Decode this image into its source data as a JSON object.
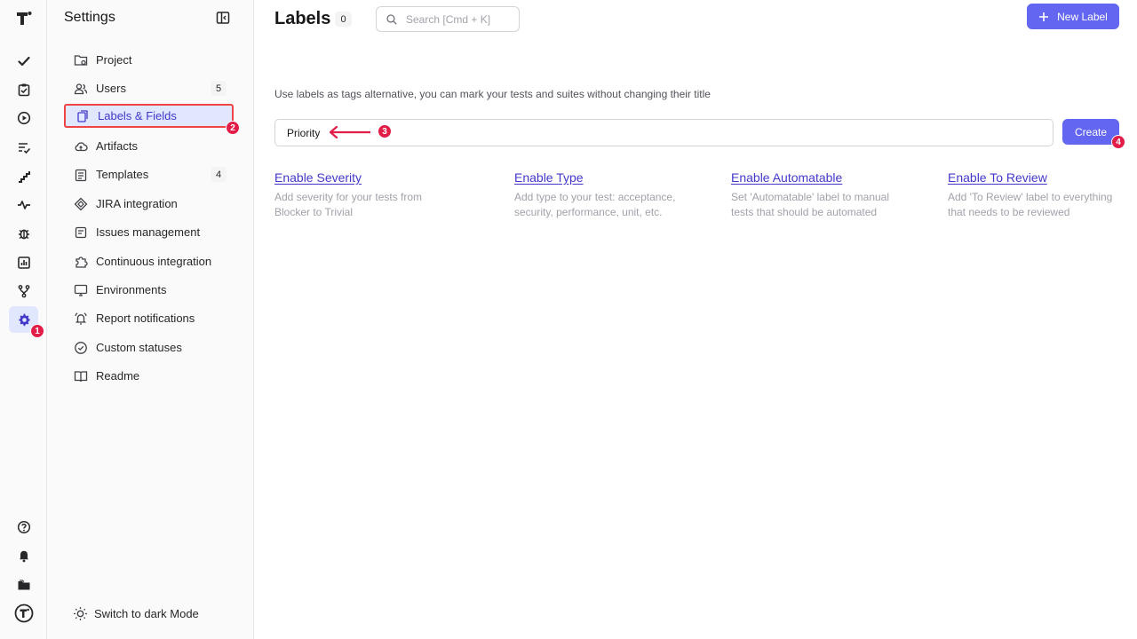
{
  "rail": {
    "items": [
      {
        "name": "checkmark-icon"
      },
      {
        "name": "clipboard-check-icon"
      },
      {
        "name": "play-circle-icon"
      },
      {
        "name": "list-check-icon"
      },
      {
        "name": "steps-icon"
      },
      {
        "name": "pulse-icon"
      },
      {
        "name": "bug-icon"
      },
      {
        "name": "bar-chart-icon"
      },
      {
        "name": "git-branch-icon"
      },
      {
        "name": "gear-icon",
        "active": true
      }
    ],
    "bottom": [
      {
        "name": "help-circle-icon"
      },
      {
        "name": "bell-icon"
      },
      {
        "name": "folder-icon"
      },
      {
        "name": "account-logo-icon"
      }
    ]
  },
  "settings": {
    "title": "Settings",
    "items": [
      {
        "label": "Project",
        "icon": "folder-gear-icon"
      },
      {
        "label": "Users",
        "icon": "users-icon",
        "badge": "5"
      },
      {
        "label": "Labels & Fields",
        "icon": "labels-icon",
        "active": true
      },
      {
        "label": "Artifacts",
        "icon": "cloud-icon"
      },
      {
        "label": "Templates",
        "icon": "clipboard-list-icon",
        "badge": "4"
      },
      {
        "label": "JIRA integration",
        "icon": "jira-icon"
      },
      {
        "label": "Issues management",
        "icon": "issues-icon"
      },
      {
        "label": "Continuous integration",
        "icon": "puzzle-icon"
      },
      {
        "label": "Environments",
        "icon": "monitor-icon"
      },
      {
        "label": "Report notifications",
        "icon": "bell-ring-icon"
      },
      {
        "label": "Custom statuses",
        "icon": "check-circle-icon"
      },
      {
        "label": "Readme",
        "icon": "book-icon"
      }
    ],
    "dark_mode_label": "Switch to dark Mode"
  },
  "main": {
    "title": "Labels",
    "count": "0",
    "search_placeholder": "Search [Cmd + K]",
    "new_label_button": "New Label",
    "description": "Use labels as tags alternative, you can mark your tests and suites without changing their title",
    "input_value": "Priority",
    "create_button": "Create",
    "options": [
      {
        "title": "Enable Severity",
        "description": "Add severity for your tests from Blocker to Trivial"
      },
      {
        "title": "Enable Type",
        "description": "Add type to your test: acceptance, security, performance, unit, etc."
      },
      {
        "title": "Enable Automatable",
        "description": "Set 'Automatable' label to manual tests that should be automated"
      },
      {
        "title": "Enable To Review",
        "description": "Add 'To Review' label to everything that needs to be reviewed"
      }
    ]
  },
  "steps": [
    "1",
    "2",
    "3",
    "4"
  ],
  "colors": {
    "accent": "#6366f1",
    "active_bg": "#e0e7ff",
    "marker": "#e11d48",
    "highlight_border": "#ef4444"
  }
}
